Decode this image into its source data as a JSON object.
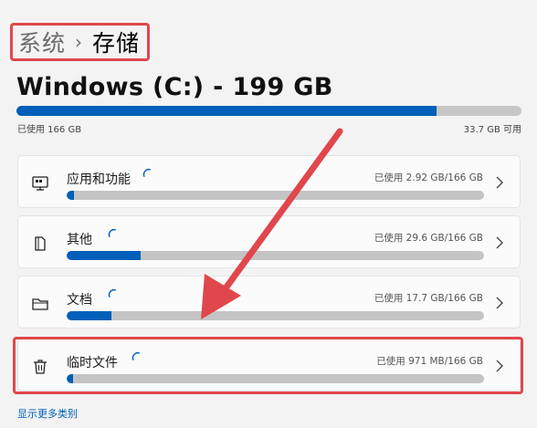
{
  "breadcrumb": {
    "parent": "系统",
    "separator": "›",
    "current": "存储"
  },
  "drive": {
    "title": "Windows (C:) - 199 GB",
    "used_label": "已使用 166 GB",
    "free_label": "33.7 GB 可用",
    "used_fraction": 0.832
  },
  "categories": [
    {
      "label": "应用和功能",
      "usage": "已使用 2.92 GB/166 GB",
      "fraction": 0.018,
      "icon": "apps-icon"
    },
    {
      "label": "其他",
      "usage": "已使用 29.6 GB/166 GB",
      "fraction": 0.178,
      "icon": "document-icon"
    },
    {
      "label": "文档",
      "usage": "已使用 17.7 GB/166 GB",
      "fraction": 0.107,
      "icon": "folder-icon"
    },
    {
      "label": "临时文件",
      "usage": "已使用 971 MB/166 GB",
      "fraction": 0.006,
      "icon": "trash-icon"
    }
  ],
  "more_link": "显示更多类别",
  "colors": {
    "accent": "#005fb8",
    "annotation": "#e0474c",
    "track": "#c4c4c4"
  }
}
